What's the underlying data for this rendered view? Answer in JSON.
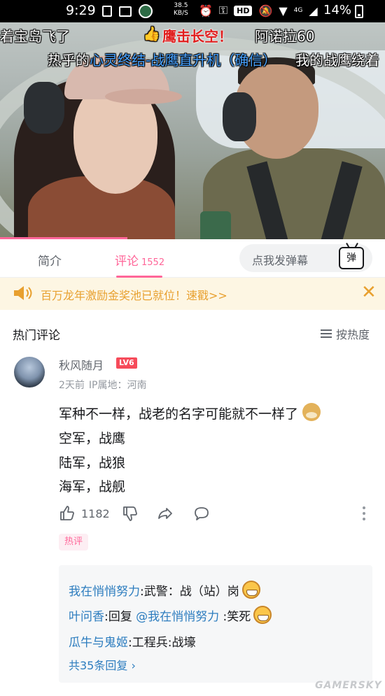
{
  "status_bar": {
    "time": "9:29",
    "net_speed_value": "38.5",
    "net_speed_unit": "KB/S",
    "hd_badge": "HD",
    "network": "4G",
    "battery": "14%"
  },
  "video": {
    "danmaku": [
      "着宝岛飞了",
      "鹰击长空！",
      "阿诺拉60",
      "热乎的",
      "心灵终结-战鹰直升机（确信）",
      "我的战鹰绕着"
    ],
    "progress_fraction": 0.33
  },
  "tabs": {
    "intro_label": "简介",
    "comments_label": "评论",
    "comments_count": "1552",
    "danmaku_placeholder": "点我发弹幕",
    "danmaku_button": "弹"
  },
  "notice": {
    "text": "百万龙年激励金奖池已就位！速戳>>",
    "color": "#e8a02f"
  },
  "comments_section": {
    "title": "热门评论",
    "sort_label": "按热度"
  },
  "comment": {
    "username": "秋风随月",
    "level_badge": "LV6",
    "time": "2天前",
    "location": "IP属地：河南",
    "lines": [
      "军种不一样，战老的名字可能就不一样了",
      "空军，战鹰",
      "陆军，战狼",
      "海军，战舰"
    ],
    "likes": "1182",
    "hot_badge": "热评",
    "replies": [
      {
        "user": "我在悄悄努力",
        "text": ":武警：战（站）岗"
      },
      {
        "user": "叶问香",
        "text": ":回复 ",
        "mention": "@我在悄悄努力",
        "text2": " :笑死"
      },
      {
        "user": "瓜牛与鬼姬",
        "text": ":工程兵:战壕"
      }
    ],
    "reply_total": "共35条回复 ›"
  },
  "watermark": "GAMERSKY",
  "colors": {
    "accent_pink": "#ff6699",
    "link_blue": "#2d7dbf",
    "level_red": "#f64b5a"
  }
}
